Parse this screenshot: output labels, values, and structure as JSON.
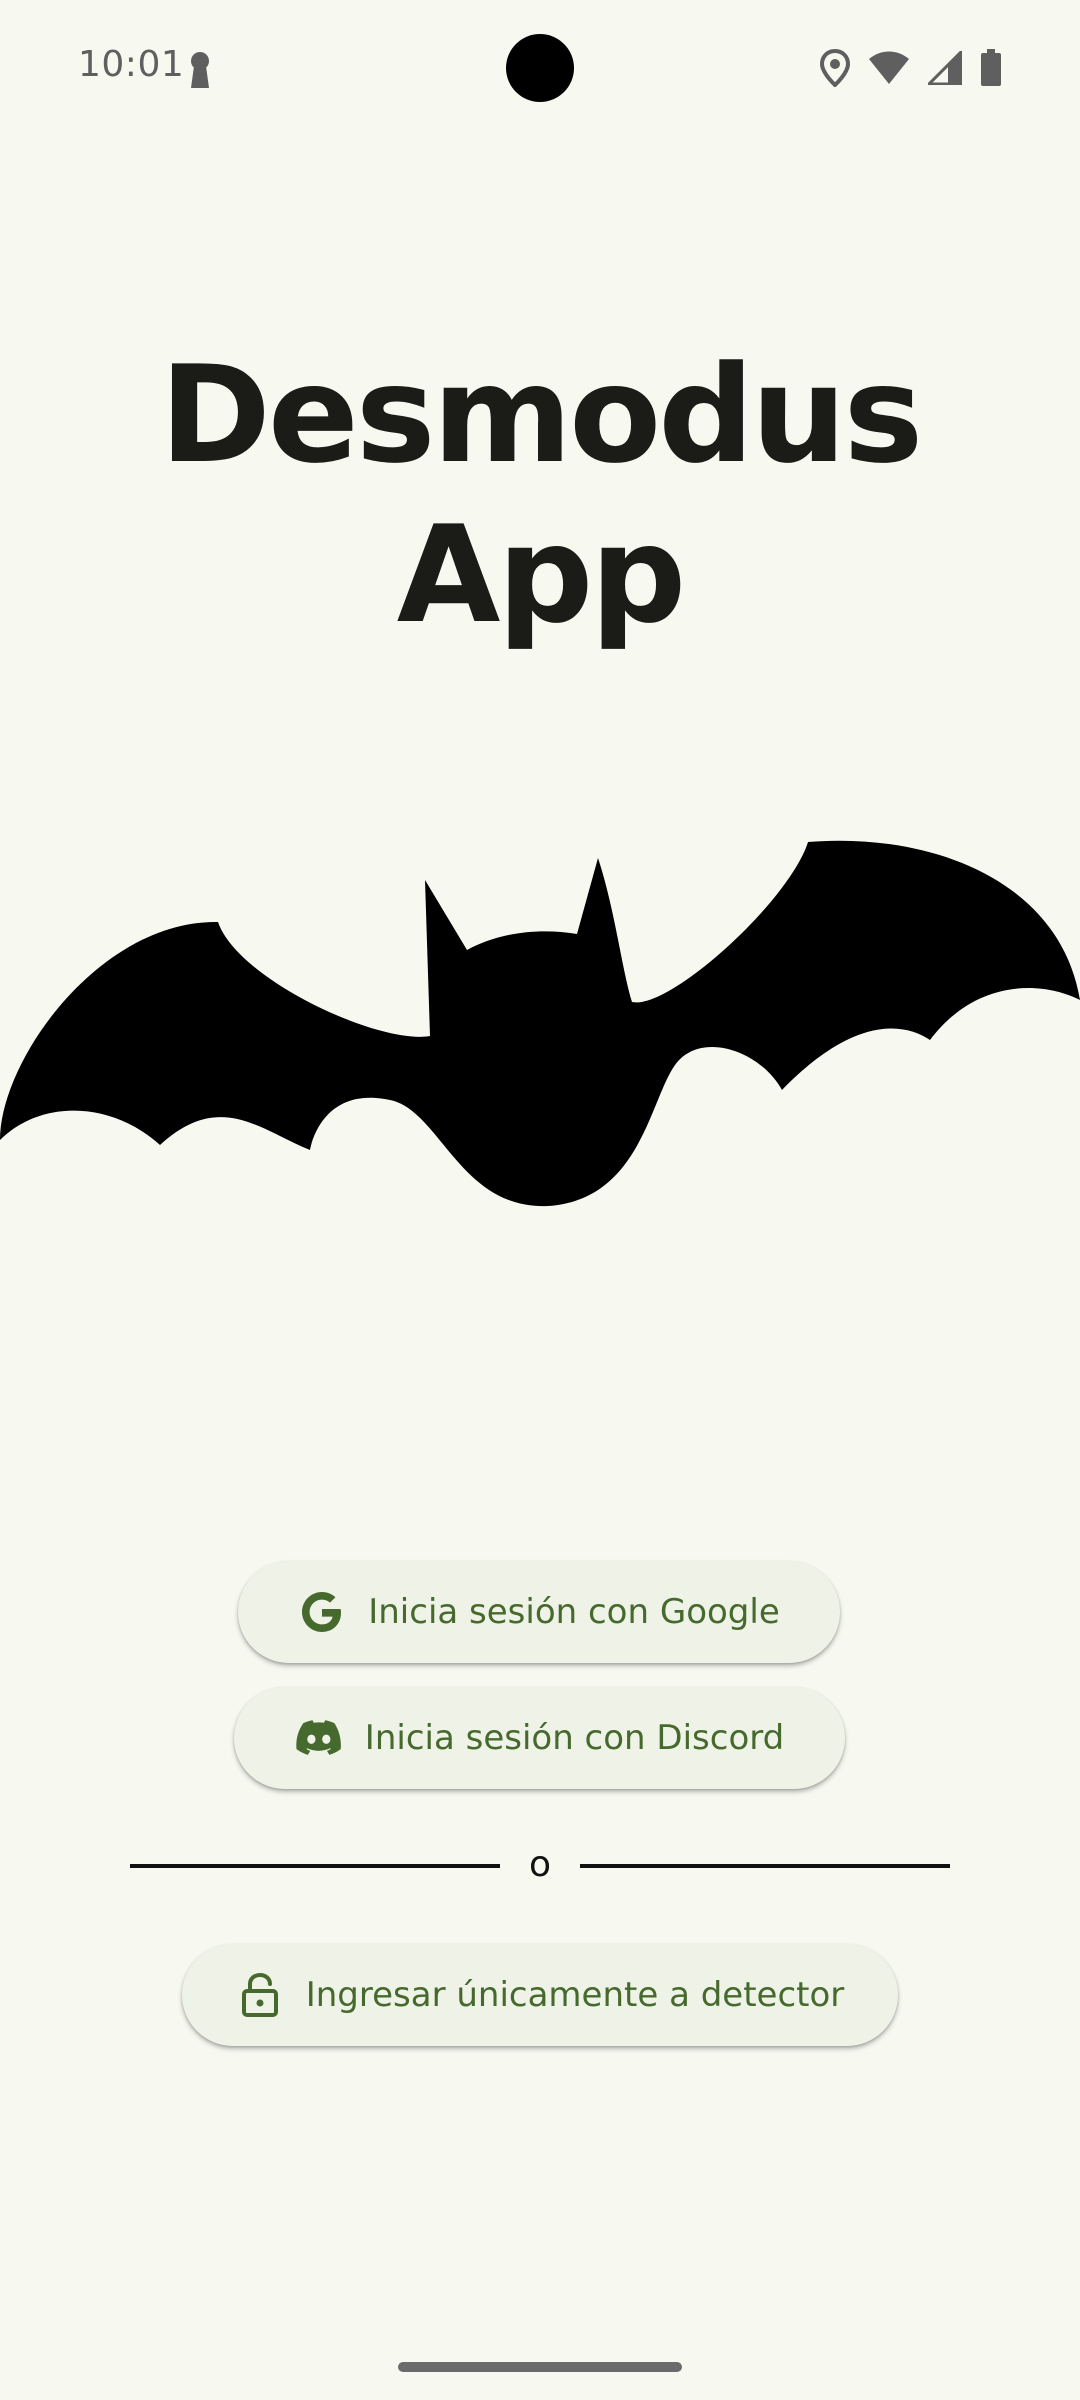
{
  "status_bar": {
    "time": "10:01",
    "icons": [
      "key-icon",
      "location-icon",
      "wifi-icon",
      "signal-icon",
      "battery-icon"
    ]
  },
  "app": {
    "title": "Desmodus App",
    "logo": "bat-logo"
  },
  "login": {
    "google_label": "Inicia sesión con Google",
    "discord_label": "Inicia sesión con Discord",
    "divider_text": "o",
    "detector_label": "Ingresar únicamente a detector"
  },
  "colors": {
    "background": "#f7f8f0",
    "button_background": "#eff2e6",
    "accent": "#466a2e",
    "title": "#1b1c18"
  }
}
